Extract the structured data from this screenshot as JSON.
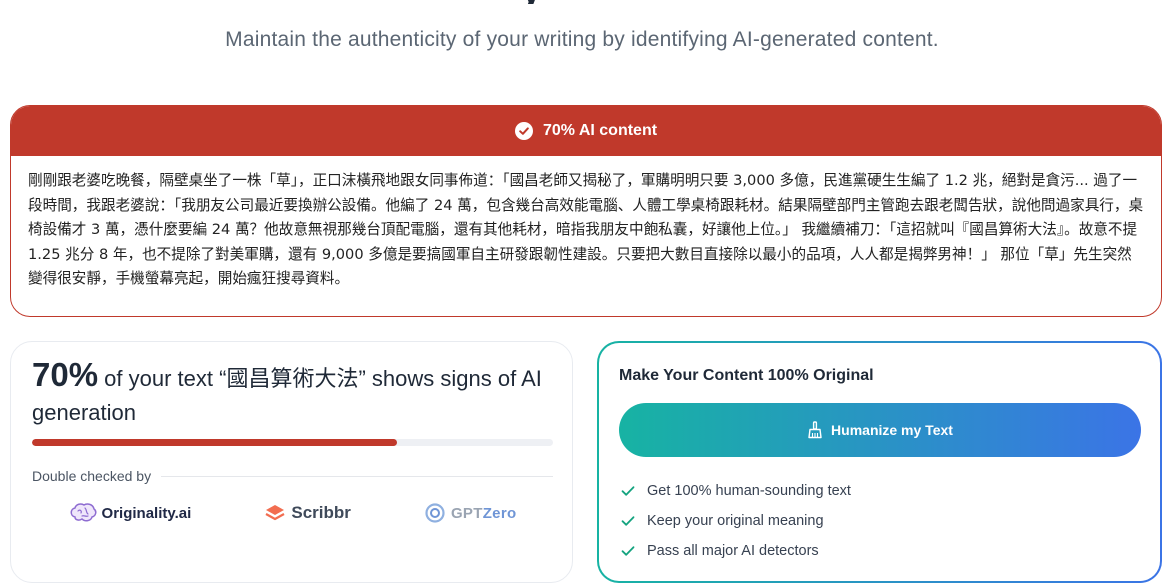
{
  "header": {
    "title_fragment": "y",
    "subtitle": "Maintain the authenticity of your writing by identifying AI-generated content."
  },
  "result": {
    "label": "70% AI content",
    "text": "剛剛跟老婆吃晚餐，隔壁桌坐了一株「草」，正口沫橫飛地跟女同事佈道：「國昌老師又揭秘了，軍購明明只要 3,000 多億，民進黨硬生生編了 1.2 兆，絕對是貪污... 過了一段時間，我跟老婆說：「我朋友公司最近要換辦公設備。他編了 24 萬，包含幾台高效能電腦、人體工學桌椅跟耗材。結果隔壁部門主管跑去跟老闆告狀，說他問過家具行，桌椅設備才 3 萬，憑什麼要編 24 萬？他故意無視那幾台頂配電腦，還有其他耗材，暗指我朋友中飽私囊，好讓他上位。」 我繼續補刀：「這招就叫『國昌算術大法』。故意不提 1.25 兆分 8 年，也不提除了對美軍購，還有 9,000 多億是要搞國軍自主研發跟韌性建設。只要把大數目直接除以最小的品項，人人都是揭弊男神！」 那位「草」先生突然變得很安靜，手機螢幕亮起，開始瘋狂搜尋資料。"
  },
  "score": {
    "percent_label": "70%",
    "sentence_mid": " of your text “",
    "highlight": "國昌算術大法",
    "sentence_end": "” shows signs of AI generation",
    "ai_fraction": 0.7,
    "checked_by_label": "Double checked by",
    "checkers": [
      {
        "name": "Originality.ai",
        "icon": "brain-icon"
      },
      {
        "name": "Scribbr",
        "icon": "scribbr-chevron-icon"
      },
      {
        "name_a": "GPT",
        "name_b": "Zero",
        "icon": "gptzero-ring-icon"
      }
    ]
  },
  "humanize": {
    "title": "Make Your Content 100% Original",
    "button_label": "Humanize my Text",
    "button_icon": "broom-icon",
    "features": [
      "Get 100% human-sounding text",
      "Keep your original meaning",
      "Pass all major AI detectors"
    ]
  },
  "colors": {
    "alert_red": "#c0392b",
    "gradient_start": "#17b3a3",
    "gradient_end": "#3b74e6",
    "check_green": "#14a37f"
  }
}
